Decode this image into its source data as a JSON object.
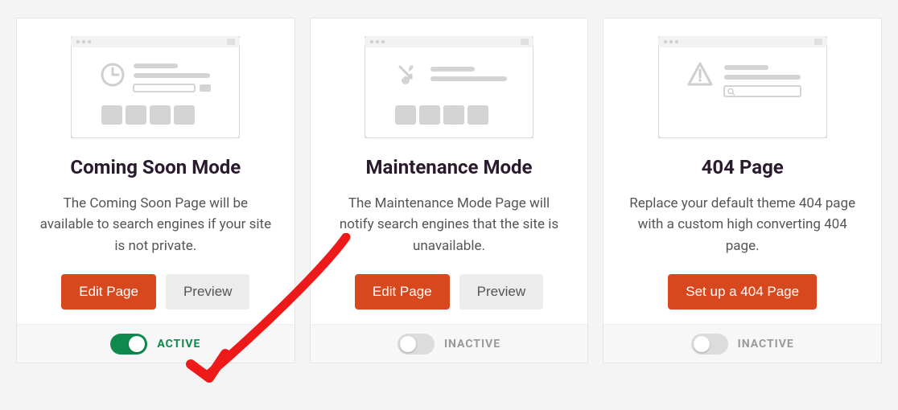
{
  "cards": [
    {
      "title": "Coming Soon Mode",
      "description": "The Coming Soon Page will be available to search engines if your site is not private.",
      "primary_label": "Edit Page",
      "secondary_label": "Preview",
      "setup_label": "",
      "status_label": "ACTIVE",
      "active": true,
      "icon": "clock-icon"
    },
    {
      "title": "Maintenance Mode",
      "description": "The Maintenance Mode Page will notify search engines that the site is unavailable.",
      "primary_label": "Edit Page",
      "secondary_label": "Preview",
      "setup_label": "",
      "status_label": "INACTIVE",
      "active": false,
      "icon": "tools-icon"
    },
    {
      "title": "404 Page",
      "description": "Replace your default theme 404 page with a custom high converting 404 page.",
      "primary_label": "",
      "secondary_label": "",
      "setup_label": "Set up a 404 Page",
      "status_label": "INACTIVE",
      "active": false,
      "icon": "warning-icon"
    }
  ]
}
